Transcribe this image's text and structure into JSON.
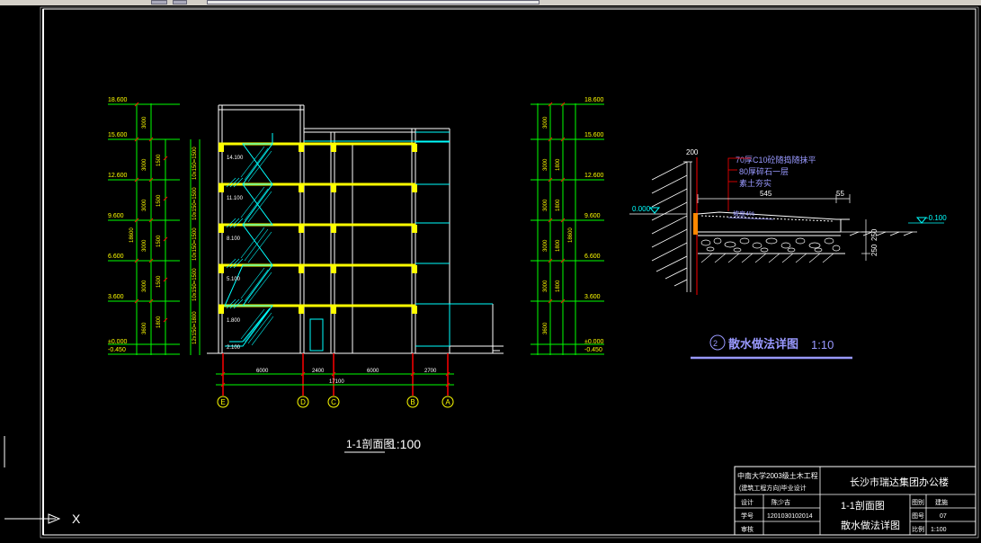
{
  "window": {
    "cmd_axis_label": "X"
  },
  "section": {
    "title": "1-1剖面图",
    "scale": "1:100",
    "left_elevations": [
      "18.600",
      "15.600",
      "12.600",
      "9.600",
      "6.600",
      "3.600",
      "±0.000",
      "-0.450"
    ],
    "right_elevations": [
      "18.600",
      "15.600",
      "12.600",
      "9.600",
      "6.600",
      "3.600",
      "±0.000",
      "-0.450"
    ],
    "floor_labels": [
      "14.100",
      "11.100",
      "8.100",
      "5.100",
      "1.800"
    ],
    "top_left_label": "18.600",
    "dims_bottom": [
      "6000",
      "2400",
      "6000",
      "2700"
    ],
    "total_dim": "17100",
    "axes": [
      "E",
      "D",
      "C",
      "B",
      "A"
    ]
  },
  "detail": {
    "notes": [
      "70厚C10砼随捣随抹平",
      "80厚碎石一层",
      "素土夯实"
    ],
    "dim_top": "545",
    "dim_top_right": "55",
    "dim_small": "200",
    "slope_label": "坡度4%",
    "level_left": "0.000",
    "level_right": "-0.100",
    "dim_right": "250",
    "dim_right2": "250",
    "title_num": "②",
    "title": "散水做法详图",
    "scale": "1:10"
  },
  "title_block": {
    "school": "中南大学2003级土木工程",
    "major": "(建筑工程方向)毕业设计",
    "project": "长沙市瑞达集团办公楼",
    "drawing_name1": "1-1剖面图",
    "drawing_name2": "散水做法详图",
    "row_design": "设计",
    "designer": "陈少吉",
    "row_id": "学号",
    "student_id": "1201030102014",
    "row_check": "审核",
    "kind_label": "图别",
    "kind_value": "建施",
    "no_label": "图号",
    "no_value": "07",
    "scale_label": "比例",
    "scale_value": "1:100"
  },
  "colors": {
    "frame": "#00ffff",
    "building": "#ffffff",
    "floor": "#ffff00",
    "column": "#ff0000",
    "stair": "#00ffff",
    "dim": "#00ff00",
    "detail_note": "#9999ff",
    "hatch": "#ffffff"
  }
}
